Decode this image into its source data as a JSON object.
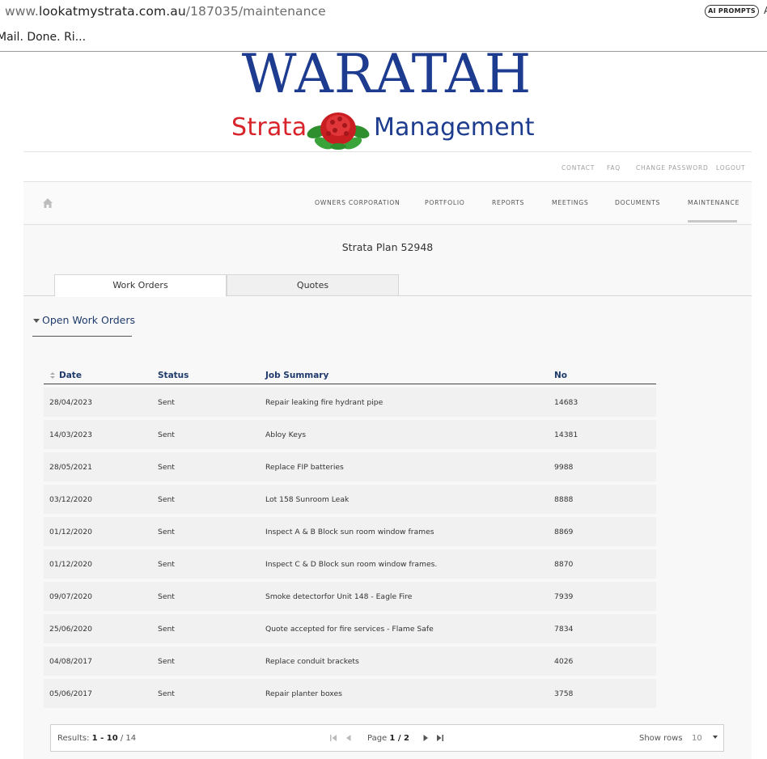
{
  "browser": {
    "url_prefix": "www.",
    "url_domain": "lookatmystrata.com.au",
    "url_path": "/187035/maintenance",
    "ai_button": "AI PROMPTS",
    "ai_extra": "A",
    "bookmark": "Mail. Done. Ri..."
  },
  "logo": {
    "line1": "WARATAH",
    "strata": "Strata",
    "management": "Management"
  },
  "top_links": [
    "CONTACT",
    "FAQ",
    "CHANGE PASSWORD",
    "LOGOUT"
  ],
  "nav": {
    "items": [
      "OWNERS CORPORATION",
      "PORTFOLIO",
      "REPORTS",
      "MEETINGS",
      "DOCUMENTS",
      "MAINTENANCE"
    ],
    "active": "MAINTENANCE"
  },
  "plan_title": "Strata Plan 52948",
  "tabs": [
    "Work Orders",
    "Quotes"
  ],
  "section_title": "Open Work Orders",
  "table": {
    "columns": [
      "Date",
      "Status",
      "Job Summary",
      "No"
    ],
    "rows": [
      [
        "28/04/2023",
        "Sent",
        "Repair leaking fire hydrant pipe",
        "14683"
      ],
      [
        "14/03/2023",
        "Sent",
        "Abloy Keys",
        "14381"
      ],
      [
        "28/05/2021",
        "Sent",
        "Replace FIP batteries",
        "9988"
      ],
      [
        "03/12/2020",
        "Sent",
        "Lot 158 Sunroom Leak",
        "8888"
      ],
      [
        "01/12/2020",
        "Sent",
        "Inspect A & B Block sun room window frames",
        "8869"
      ],
      [
        "01/12/2020",
        "Sent",
        "Inspect C & D Block sun room window frames.",
        "8870"
      ],
      [
        "09/07/2020",
        "Sent",
        "Smoke detectorfor Unit 148 - Eagle Fire",
        "7939"
      ],
      [
        "25/06/2020",
        "Sent",
        "Quote accepted for fire services - Flame Safe",
        "7834"
      ],
      [
        "04/08/2017",
        "Sent",
        "Replace conduit brackets",
        "4026"
      ],
      [
        "05/06/2017",
        "Sent",
        "Repair planter boxes",
        "3758"
      ]
    ]
  },
  "pager": {
    "results_label": "Results:",
    "results_range": "1 - 10",
    "results_total": "/ 14",
    "page_label": "Page",
    "page_value": "1 / 2",
    "show_rows_label": "Show rows",
    "rows_value": "10"
  },
  "colors": {
    "brand_blue": "#1d3c8f",
    "brand_red": "#d8232a",
    "heading_blue": "#1f3b6b"
  }
}
